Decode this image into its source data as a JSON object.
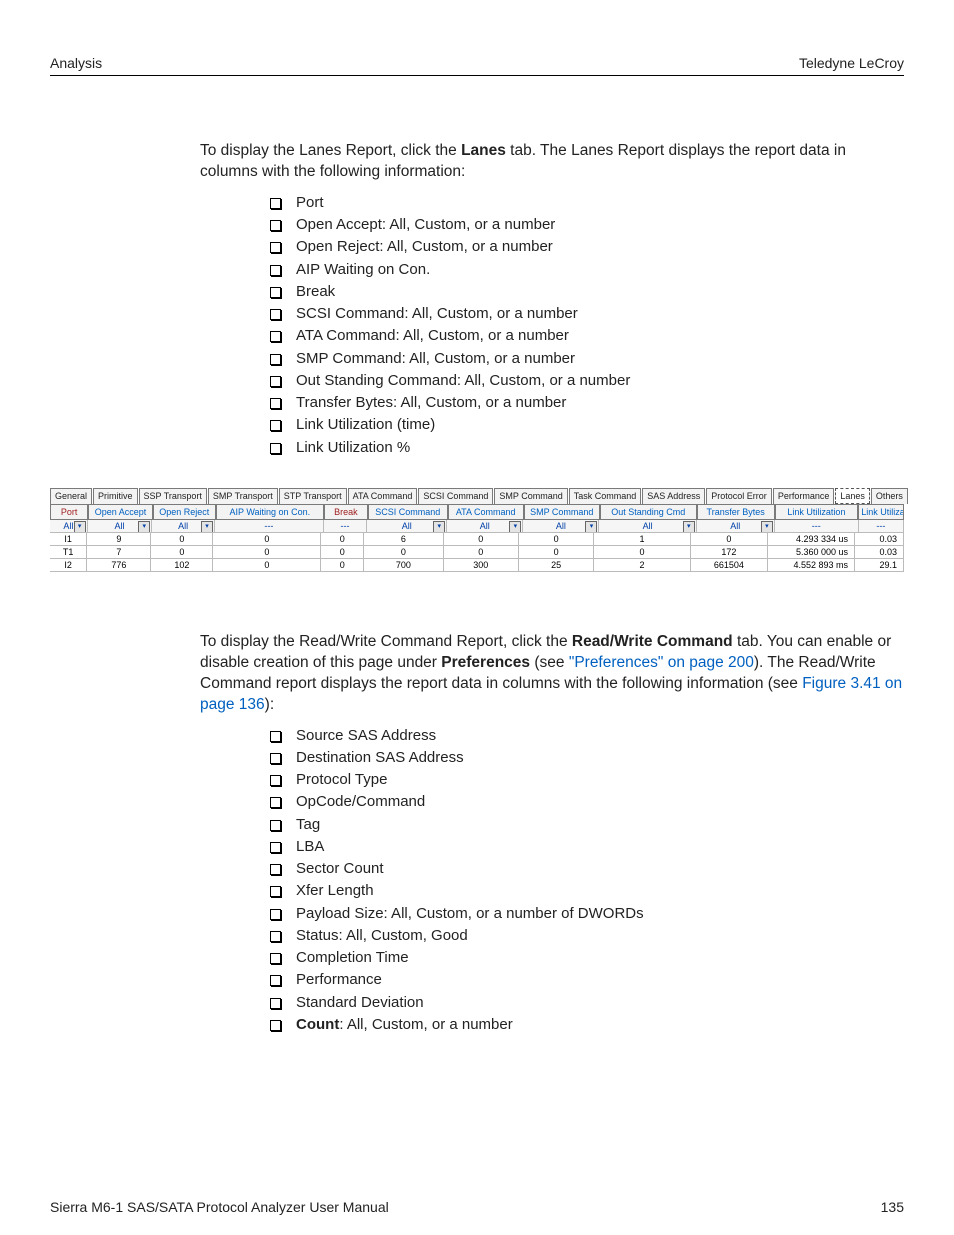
{
  "header": {
    "left": "Analysis",
    "right": "Teledyne LeCroy"
  },
  "intro": {
    "pre": "To display the Lanes Report, click the ",
    "bold": "Lanes",
    "post": " tab. The Lanes Report displays the report data in columns with the following information:"
  },
  "list1": [
    "Port",
    "Open Accept: All, Custom, or a number",
    "Open Reject: All, Custom, or a number",
    "AIP Waiting on Con.",
    "Break",
    "SCSI Command: All, Custom, or a number",
    "ATA Command: All, Custom, or a number",
    "SMP Command: All, Custom, or a number",
    "Out Standing Command: All, Custom, or a number",
    "Transfer Bytes: All, Custom, or a number",
    "Link Utilization (time)",
    "Link Utilization %"
  ],
  "tabs": [
    "General",
    "Primitive",
    "SSP Transport",
    "SMP Transport",
    "STP Transport",
    "ATA Command",
    "SCSI Command",
    "SMP Command",
    "Task Command",
    "SAS Address",
    "Protocol Error",
    "Performance",
    "Lanes",
    "Others"
  ],
  "activeTab": "Lanes",
  "cols": [
    "Port",
    "Open Accept",
    "Open Reject",
    "AIP Waiting on Con.",
    "Break",
    "SCSI Command",
    "ATA Command",
    "SMP Command",
    "Out Standing Cmd",
    "Transfer Bytes",
    "Link Utilization",
    "Link Utiliza"
  ],
  "filters": [
    "All",
    "All",
    "All",
    "---",
    "---",
    "All",
    "All",
    "All",
    "All",
    "All",
    "---",
    "---"
  ],
  "dd": [
    true,
    true,
    true,
    false,
    false,
    true,
    true,
    true,
    true,
    true,
    false,
    false
  ],
  "rows": [
    [
      "I1",
      "9",
      "0",
      "0",
      "0",
      "6",
      "0",
      "0",
      "1",
      "0",
      "4.293 334  us",
      "0.03"
    ],
    [
      "T1",
      "7",
      "0",
      "0",
      "0",
      "0",
      "0",
      "0",
      "0",
      "172",
      "5.360 000  us",
      "0.03"
    ],
    [
      "I2",
      "776",
      "102",
      "0",
      "0",
      "700",
      "300",
      "25",
      "2",
      "661504",
      "4.552 893  ms",
      "29.1"
    ]
  ],
  "para2": {
    "t1": "To display the Read/Write Command Report, click the ",
    "b1": "Read/Write Command",
    "t2": " tab. You can enable or disable creation of this page under ",
    "b2": "Preferences",
    "t3": " (see ",
    "l1": "\"Preferences\" on page 200",
    "t4": "). The Read/Write Command report displays the report data in columns with the following information (see ",
    "l2": "Figure 3.41 on page 136",
    "t5": "):"
  },
  "list2": [
    {
      "text": "Source SAS Address"
    },
    {
      "text": "Destination SAS Address"
    },
    {
      "text": "Protocol Type"
    },
    {
      "text": "OpCode/Command"
    },
    {
      "text": "Tag"
    },
    {
      "text": "LBA"
    },
    {
      "text": "Sector Count"
    },
    {
      "text": "Xfer Length"
    },
    {
      "text": "Payload Size: All, Custom, or a number of DWORDs"
    },
    {
      "text": "Status: All, Custom, Good"
    },
    {
      "text": "Completion Time"
    },
    {
      "text": "Performance"
    },
    {
      "text": "Standard Deviation"
    },
    {
      "bold": "Count",
      "text": ": All, Custom, or a number"
    }
  ],
  "footer": {
    "title": "Sierra M6-1 SAS/SATA Protocol Analyzer User Manual",
    "page": "135"
  }
}
